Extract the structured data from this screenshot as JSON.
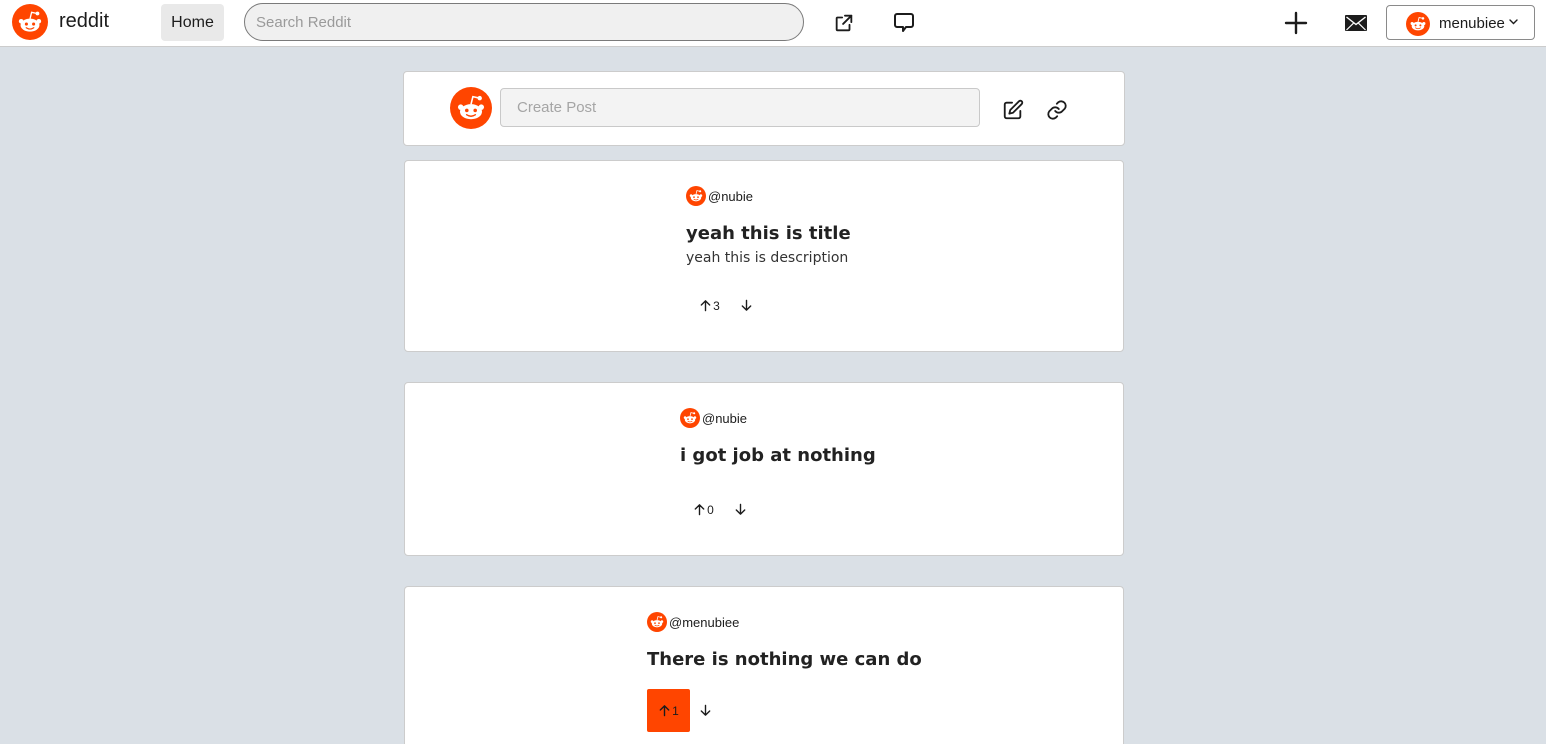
{
  "header": {
    "brand": "reddit",
    "home_label": "Home",
    "search_placeholder": "Search Reddit",
    "username": "menubiee"
  },
  "create_post": {
    "placeholder": "Create Post"
  },
  "colors": {
    "accent": "#ff4500",
    "background": "#dae0e6"
  },
  "posts": [
    {
      "author": "@nubie",
      "title": "yeah this is title",
      "description": "yeah this is description",
      "votes": "3",
      "upvoted": false
    },
    {
      "author": "@nubie",
      "title": "i got job at nothing",
      "description": "",
      "votes": "0",
      "upvoted": false
    },
    {
      "author": "@menubiee",
      "title": "There is nothing we can do",
      "description": "",
      "votes": "1",
      "upvoted": true
    }
  ]
}
